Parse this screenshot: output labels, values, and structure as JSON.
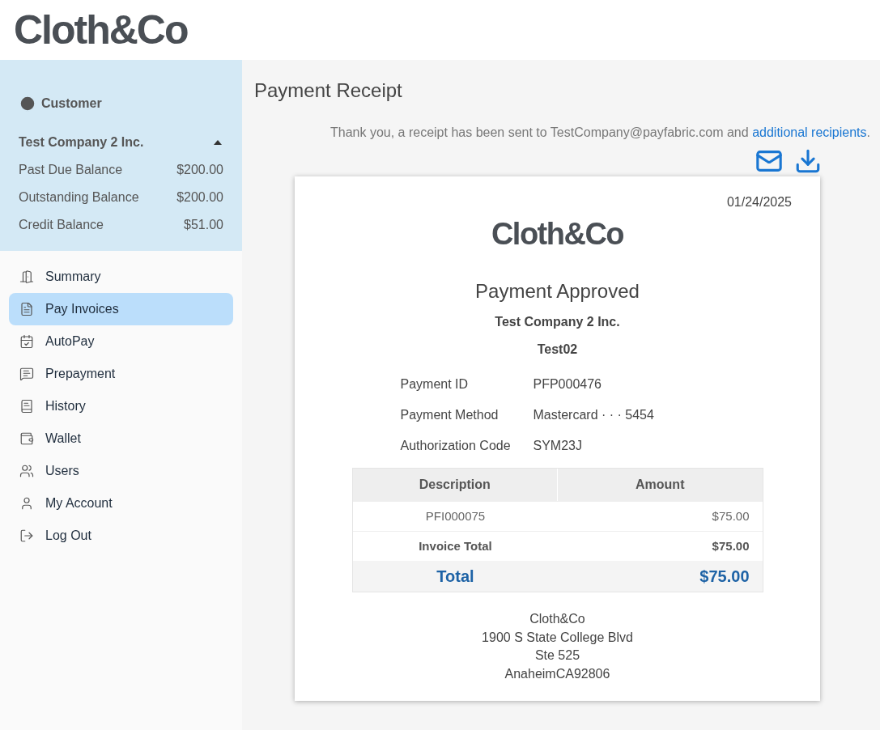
{
  "header": {
    "logo": "Cloth&Co"
  },
  "customer": {
    "heading": "Customer",
    "company": "Test Company 2 Inc.",
    "expanded": true,
    "balances": [
      {
        "label": "Past Due Balance",
        "value": "$200.00"
      },
      {
        "label": "Outstanding Balance",
        "value": "$200.00"
      },
      {
        "label": "Credit Balance",
        "value": "$51.00"
      }
    ]
  },
  "nav": [
    {
      "label": "Summary",
      "selected": false
    },
    {
      "label": "Pay Invoices",
      "selected": true
    },
    {
      "label": "AutoPay",
      "selected": false
    },
    {
      "label": "Prepayment",
      "selected": false
    },
    {
      "label": "History",
      "selected": false
    },
    {
      "label": "Wallet",
      "selected": false
    },
    {
      "label": "Users",
      "selected": false
    },
    {
      "label": "My Account",
      "selected": false
    },
    {
      "label": "Log Out",
      "selected": false
    }
  ],
  "page": {
    "title": "Payment Receipt",
    "notice": "Thank you, a receipt has been sent to TestCompany@payfabric.com and",
    "notice_link": "additional recipients",
    "notice_end": "."
  },
  "receipt": {
    "date": "01/24/2025",
    "logo": "Cloth&Co",
    "status": "Payment Approved",
    "company": "Test Company 2 Inc.",
    "customer_id": "Test02",
    "details": [
      {
        "label": "Payment ID",
        "value": "PFP000476"
      },
      {
        "label": "Payment Method",
        "value": "Mastercard · · · 5454"
      },
      {
        "label": "Authorization Code",
        "value": "SYM23J"
      }
    ],
    "table": {
      "columns": [
        "Description",
        "Amount"
      ],
      "rows": [
        {
          "kind": "item",
          "description": "PFI000075",
          "amount": "$75.00"
        },
        {
          "kind": "subtotal",
          "description": "Invoice Total",
          "amount": "$75.00"
        },
        {
          "kind": "total",
          "description": "Total",
          "amount": "$75.00"
        }
      ]
    },
    "address": [
      "Cloth&Co",
      "1900 S State College Blvd",
      "Ste 525",
      "AnaheimCA92806"
    ]
  }
}
